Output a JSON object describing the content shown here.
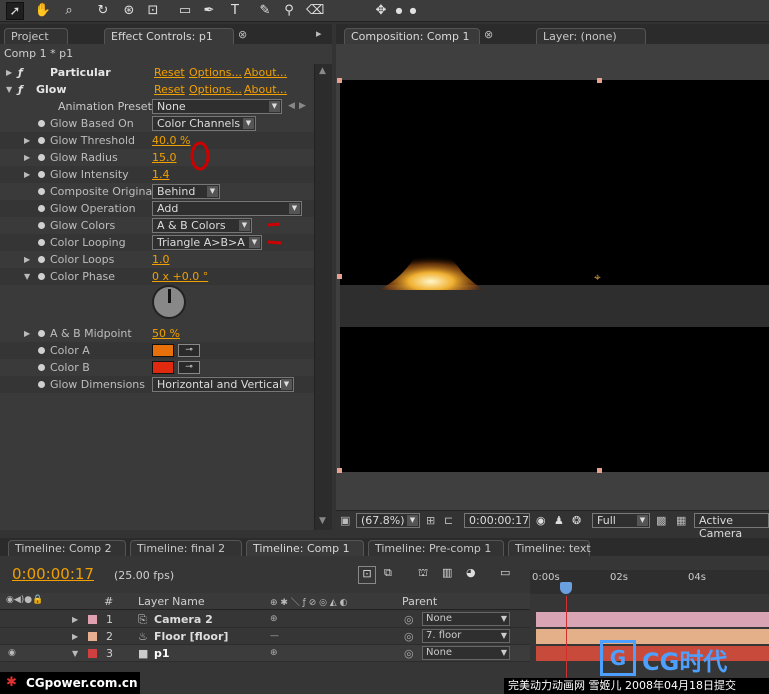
{
  "toolbar": {
    "tools": [
      "selection-tool",
      "hand-tool",
      "zoom-tool",
      "rotation-tool",
      "orbit-camera-tool",
      "pan-behind-tool",
      "rectangle-tool",
      "pen-tool",
      "type-tool",
      "brush-tool",
      "clone-stamp-tool",
      "eraser-tool",
      "puppet-tool"
    ]
  },
  "left_panel": {
    "tab_project": "Project",
    "tab_effect_controls": "Effect Controls: p1",
    "breadcrumb": "Comp 1 * p1"
  },
  "effects": [
    {
      "name": "Particular",
      "reset": "Reset",
      "options": "Options...",
      "about": "About..."
    },
    {
      "name": "Glow",
      "reset": "Reset",
      "options": "Options...",
      "about": "About..."
    }
  ],
  "animation_presets": {
    "label": "Animation Presets:",
    "value": "None"
  },
  "glow_props": [
    {
      "label": "Glow Based On",
      "type": "dropdown",
      "value": "Color Channels"
    },
    {
      "label": "Glow Threshold",
      "type": "value",
      "value": "40.0 %"
    },
    {
      "label": "Glow Radius",
      "type": "value",
      "value": "15.0"
    },
    {
      "label": "Glow Intensity",
      "type": "value",
      "value": "1.4"
    },
    {
      "label": "Composite Original",
      "type": "dropdown",
      "value": "Behind"
    },
    {
      "label": "Glow Operation",
      "type": "dropdown",
      "value": "Add"
    },
    {
      "label": "Glow Colors",
      "type": "dropdown",
      "value": "A & B Colors"
    },
    {
      "label": "Color Looping",
      "type": "dropdown",
      "value": "Triangle A>B>A"
    },
    {
      "label": "Color Loops",
      "type": "value",
      "value": "1.0"
    },
    {
      "label": "Color Phase",
      "type": "value",
      "value": "0 x +0.0 °"
    },
    {
      "label": "A & B Midpoint",
      "type": "value",
      "value": "50 %"
    },
    {
      "label": "Color A",
      "type": "color",
      "value": "#e8700a"
    },
    {
      "label": "Color B",
      "type": "color",
      "value": "#e02a10"
    },
    {
      "label": "Glow Dimensions",
      "type": "dropdown",
      "value": "Horizontal and Vertical"
    }
  ],
  "viewer": {
    "tab_composition": "Composition: Comp 1",
    "tab_layer": "Layer: (none)",
    "zoom": "(67.8%)",
    "timecode": "0:00:00:17",
    "resolution": "Full",
    "camera": "Active Camera"
  },
  "timeline": {
    "tabs": [
      "Timeline: Comp 2",
      "Timeline: final 2",
      "Timeline: Comp 1",
      "Timeline: Pre-comp 1",
      "Timeline: text"
    ],
    "active_tab": 2,
    "current_time": "0:00:00:17",
    "fps": "(25.00 fps)",
    "col_hash": "#",
    "col_layer_name": "Layer Name",
    "col_parent": "Parent",
    "ruler": [
      "0:00s",
      "02s",
      "04s"
    ],
    "layers": [
      {
        "num": "1",
        "name": "Camera 2",
        "parent": "None",
        "color": "#e0a0b0",
        "bar": "#d9a5b5"
      },
      {
        "num": "2",
        "name": "Floor [floor]",
        "parent": "7. floor",
        "color": "#e8b090",
        "bar": "#e3b089"
      },
      {
        "num": "3",
        "name": "p1",
        "parent": "None",
        "color": "#d04040",
        "bar": "#c84a3a"
      }
    ]
  },
  "watermark": {
    "left": "CGpower.com.cn",
    "right": "完美动力动画网 雪姬儿 2008年04月18日提交",
    "logo": "CG时代"
  }
}
